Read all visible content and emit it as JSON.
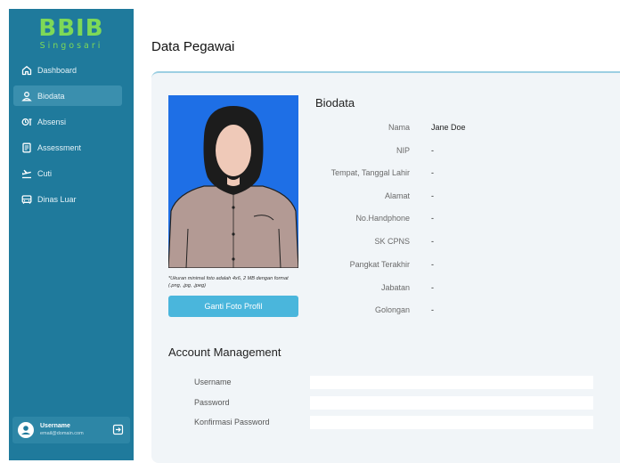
{
  "brand": {
    "name": "BBIB",
    "sub": "Singosari"
  },
  "sidebar": {
    "items": [
      {
        "label": "Dashboard",
        "icon": "home-icon"
      },
      {
        "label": "Biodata",
        "icon": "user-icon",
        "active": true
      },
      {
        "label": "Absensi",
        "icon": "clock-icon"
      },
      {
        "label": "Assessment",
        "icon": "document-icon"
      },
      {
        "label": "Cuti",
        "icon": "plane-icon"
      },
      {
        "label": "Dinas Luar",
        "icon": "car-icon"
      }
    ],
    "user": {
      "name": "Username",
      "email": "email@domain.com"
    }
  },
  "page": {
    "title": "Data Pegawai"
  },
  "photo": {
    "note": "*Ukuran minimal foto adalah 4x6, 2 MB dengan format (.png, .jpg, .jpeg)",
    "button": "Ganti Foto Profil"
  },
  "biodata": {
    "title": "Biodata",
    "rows": [
      {
        "label": "Nama",
        "value": "Jane Doe"
      },
      {
        "label": "NIP",
        "value": "-"
      },
      {
        "label": "Tempat, Tanggal Lahir",
        "value": "-"
      },
      {
        "label": "Alamat",
        "value": "-"
      },
      {
        "label": "No.Handphone",
        "value": "-"
      },
      {
        "label": "SK CPNS",
        "value": "-"
      },
      {
        "label": "Pangkat Terakhir",
        "value": "-"
      },
      {
        "label": "Jabatan",
        "value": "-"
      },
      {
        "label": "Golongan",
        "value": "-"
      }
    ]
  },
  "account": {
    "title": "Account Management",
    "fields": [
      {
        "label": "Username",
        "value": ""
      },
      {
        "label": "Password",
        "value": ""
      },
      {
        "label": "Konfirmasi Password",
        "value": ""
      }
    ]
  },
  "colors": {
    "sidebar": "#1f7a9c",
    "brand": "#7ed957",
    "accent": "#4ab6dc",
    "photo_bg": "#1e6fe6"
  }
}
